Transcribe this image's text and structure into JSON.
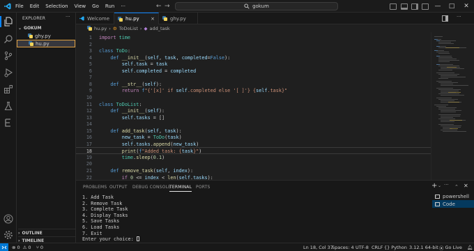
{
  "titlebar": {
    "menu": [
      "File",
      "Edit",
      "Selection",
      "View",
      "Go",
      "Run",
      "···"
    ],
    "search_text": "gokum",
    "nav_back": "←",
    "nav_forward": "→"
  },
  "sidebar": {
    "title": "EXPLORER",
    "more": "···",
    "folder": "GOKUM",
    "files": [
      {
        "name": "ghy.py",
        "selected": false
      },
      {
        "name": "hu.py",
        "selected": true
      }
    ],
    "outline": "OUTLINE",
    "timeline": "TIMELINE"
  },
  "tabs": [
    {
      "label": "Welcome",
      "icon": "vscode-icon",
      "active": false
    },
    {
      "label": "hu.py",
      "icon": "python-file-icon",
      "active": true,
      "close": "×"
    },
    {
      "label": "ghy.py",
      "icon": "python-file-icon",
      "active": false
    }
  ],
  "breadcrumb": {
    "file": "hu.py",
    "class_name": "ToDoList",
    "method": "add_task",
    "sep": "›"
  },
  "code": {
    "current_line": 18,
    "lines": [
      {
        "n": "1",
        "t": [
          [
            "kw2",
            "import"
          ],
          [
            "txt",
            " "
          ],
          [
            "cls",
            "time"
          ]
        ]
      },
      {
        "n": "2",
        "t": []
      },
      {
        "n": "3",
        "t": [
          [
            "kw",
            "class"
          ],
          [
            "txt",
            " "
          ],
          [
            "cls",
            "ToDo"
          ],
          [
            "txt",
            ":"
          ]
        ]
      },
      {
        "n": "4",
        "t": [
          [
            "txt",
            "    "
          ],
          [
            "kw",
            "def"
          ],
          [
            "txt",
            " "
          ],
          [
            "fn",
            "__init__"
          ],
          [
            "txt",
            "("
          ],
          [
            "var",
            "self"
          ],
          [
            "txt",
            ", "
          ],
          [
            "var",
            "task"
          ],
          [
            "txt",
            ", "
          ],
          [
            "var",
            "completed"
          ],
          [
            "txt",
            "="
          ],
          [
            "kw",
            "False"
          ],
          [
            "txt",
            "):"
          ]
        ]
      },
      {
        "n": "5",
        "t": [
          [
            "txt",
            "        "
          ],
          [
            "var",
            "self"
          ],
          [
            "txt",
            "."
          ],
          [
            "var",
            "task"
          ],
          [
            "txt",
            " = "
          ],
          [
            "var",
            "task"
          ]
        ]
      },
      {
        "n": "6",
        "t": [
          [
            "txt",
            "        "
          ],
          [
            "var",
            "self"
          ],
          [
            "txt",
            "."
          ],
          [
            "var",
            "completed"
          ],
          [
            "txt",
            " = "
          ],
          [
            "var",
            "completed"
          ]
        ]
      },
      {
        "n": "7",
        "t": []
      },
      {
        "n": "8",
        "t": [
          [
            "txt",
            "    "
          ],
          [
            "kw",
            "def"
          ],
          [
            "txt",
            " "
          ],
          [
            "fn",
            "__str__"
          ],
          [
            "txt",
            "("
          ],
          [
            "var",
            "self"
          ],
          [
            "txt",
            "):"
          ]
        ]
      },
      {
        "n": "9",
        "t": [
          [
            "txt",
            "        "
          ],
          [
            "kw2",
            "return"
          ],
          [
            "txt",
            " "
          ],
          [
            "kw",
            "f"
          ],
          [
            "str",
            "\"{'[x]' if "
          ],
          [
            "var",
            "self"
          ],
          [
            "str",
            ".completed else '[ ]'} {"
          ],
          [
            "var",
            "self"
          ],
          [
            "str",
            ".task}\""
          ]
        ]
      },
      {
        "n": "10",
        "t": []
      },
      {
        "n": "11",
        "t": [
          [
            "kw",
            "class"
          ],
          [
            "txt",
            " "
          ],
          [
            "cls",
            "ToDoList"
          ],
          [
            "txt",
            ":"
          ]
        ]
      },
      {
        "n": "12",
        "t": [
          [
            "txt",
            "    "
          ],
          [
            "kw",
            "def"
          ],
          [
            "txt",
            " "
          ],
          [
            "fn",
            "__init__"
          ],
          [
            "txt",
            "("
          ],
          [
            "var",
            "self"
          ],
          [
            "txt",
            "):"
          ]
        ]
      },
      {
        "n": "13",
        "t": [
          [
            "txt",
            "        "
          ],
          [
            "var",
            "self"
          ],
          [
            "txt",
            "."
          ],
          [
            "var",
            "tasks"
          ],
          [
            "txt",
            " = []"
          ]
        ]
      },
      {
        "n": "14",
        "t": []
      },
      {
        "n": "15",
        "t": [
          [
            "txt",
            "    "
          ],
          [
            "kw",
            "def"
          ],
          [
            "txt",
            " "
          ],
          [
            "fn",
            "add_task"
          ],
          [
            "txt",
            "("
          ],
          [
            "var",
            "self"
          ],
          [
            "txt",
            ", "
          ],
          [
            "var",
            "task"
          ],
          [
            "txt",
            "):"
          ]
        ]
      },
      {
        "n": "16",
        "t": [
          [
            "txt",
            "        "
          ],
          [
            "var",
            "new_task"
          ],
          [
            "txt",
            " = "
          ],
          [
            "cls",
            "ToDo"
          ],
          [
            "txt",
            "("
          ],
          [
            "var",
            "task"
          ],
          [
            "txt",
            ")"
          ]
        ]
      },
      {
        "n": "17",
        "t": [
          [
            "txt",
            "        "
          ],
          [
            "var",
            "self"
          ],
          [
            "txt",
            "."
          ],
          [
            "var",
            "tasks"
          ],
          [
            "txt",
            "."
          ],
          [
            "fn",
            "append"
          ],
          [
            "txt",
            "("
          ],
          [
            "var",
            "new_task"
          ],
          [
            "txt",
            ")"
          ]
        ]
      },
      {
        "n": "18",
        "t": [
          [
            "txt",
            "        "
          ],
          [
            "fn",
            "print"
          ],
          [
            "txt",
            "("
          ],
          [
            "kw",
            "f"
          ],
          [
            "str",
            "\"Added task: {"
          ],
          [
            "var",
            "task"
          ],
          [
            "str",
            "}\""
          ],
          [
            "txt",
            ")"
          ]
        ]
      },
      {
        "n": "19",
        "t": [
          [
            "txt",
            "        "
          ],
          [
            "cls",
            "time"
          ],
          [
            "txt",
            "."
          ],
          [
            "fn",
            "sleep"
          ],
          [
            "txt",
            "("
          ],
          [
            "num",
            "0.1"
          ],
          [
            "txt",
            ")"
          ]
        ]
      },
      {
        "n": "20",
        "t": []
      },
      {
        "n": "21",
        "t": [
          [
            "txt",
            "    "
          ],
          [
            "kw",
            "def"
          ],
          [
            "txt",
            " "
          ],
          [
            "fn",
            "remove_task"
          ],
          [
            "txt",
            "("
          ],
          [
            "var",
            "self"
          ],
          [
            "txt",
            ", "
          ],
          [
            "var",
            "index"
          ],
          [
            "txt",
            "):"
          ]
        ]
      },
      {
        "n": "22",
        "t": [
          [
            "txt",
            "        "
          ],
          [
            "kw2",
            "if"
          ],
          [
            "txt",
            " "
          ],
          [
            "num",
            "0"
          ],
          [
            "txt",
            " <= "
          ],
          [
            "var",
            "index"
          ],
          [
            "txt",
            " < "
          ],
          [
            "fn",
            "len"
          ],
          [
            "txt",
            "("
          ],
          [
            "var",
            "self"
          ],
          [
            "txt",
            "."
          ],
          [
            "var",
            "tasks"
          ],
          [
            "txt",
            "):"
          ]
        ]
      }
    ]
  },
  "panel": {
    "tabs": [
      "PROBLEMS",
      "OUTPUT",
      "DEBUG CONSOLE",
      "TERMINAL",
      "PORTS"
    ],
    "active_tab": "TERMINAL",
    "terminal_lines": [
      "1. Add Task",
      "2. Remove Task",
      "3. Complete Task",
      "4. Display Tasks",
      "5. Save Tasks",
      "6. Load Tasks",
      "7. Exit",
      "Enter your choice: "
    ],
    "terminals": [
      {
        "label": "powershell",
        "active": false
      },
      {
        "label": "Code",
        "active": true
      }
    ],
    "add_label": "+",
    "more": "···"
  },
  "status": {
    "errors": "0",
    "warnings": "0",
    "ports": "0",
    "position": "Ln 18, Col 37",
    "spaces": "Spaces: 4",
    "encoding": "UTF-8",
    "eol": "CRLF",
    "language": "Python",
    "interpreter": "3.12.1 64-bit",
    "golive": "Go Live",
    "accent": "#0078d4"
  }
}
